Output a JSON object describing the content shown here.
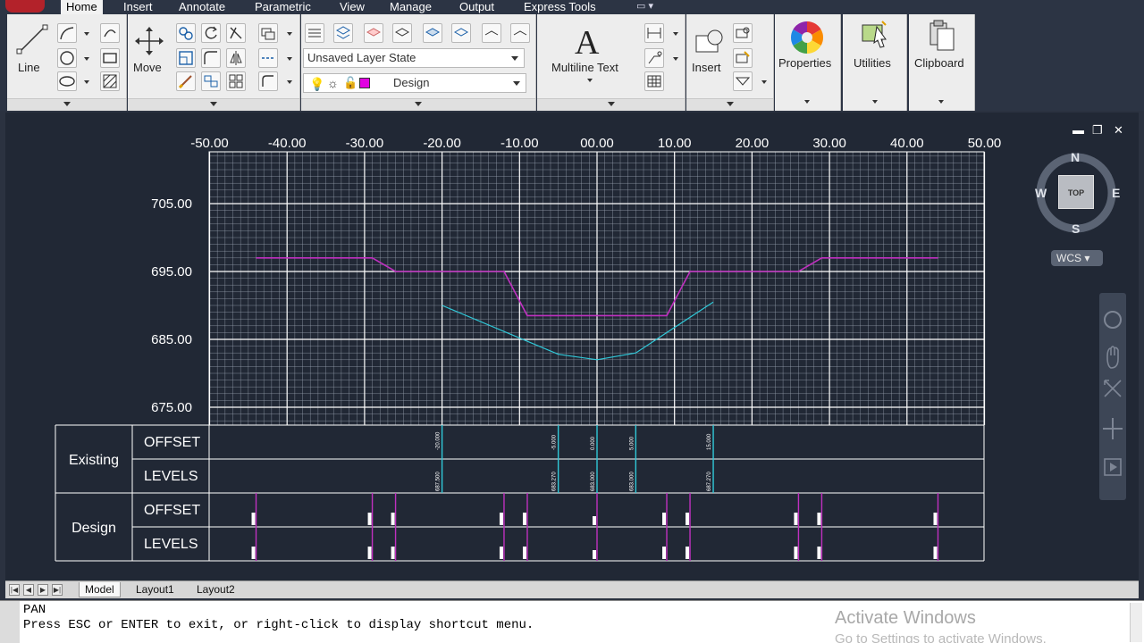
{
  "tabs": [
    "Home",
    "Insert",
    "Annotate",
    "Parametric",
    "View",
    "Manage",
    "Output",
    "Express Tools"
  ],
  "ribbon": {
    "draw": {
      "line_label": "Line"
    },
    "modify": {
      "move_label": "Move"
    },
    "layers": {
      "layer_state": "Unsaved Layer State",
      "current_layer": "Design",
      "layer_color": "#e100e1"
    },
    "annotation": {
      "mtext_label": "Multiline Text"
    },
    "block": {
      "insert_label": "Insert"
    },
    "properties_label": "Properties",
    "utilities_label": "Utilities",
    "clipboard_label": "Clipboard"
  },
  "viewport": {
    "window_controls": [
      "▬",
      "❐",
      "✕"
    ],
    "viewcube": {
      "north": "N",
      "south": "S",
      "east": "E",
      "west": "W",
      "face": "TOP",
      "wcs": "WCS"
    }
  },
  "section": {
    "x_ticks": [
      "-50.00",
      "-40.00",
      "-30.00",
      "-20.00",
      "-10.00",
      "00.00",
      "10.00",
      "20.00",
      "30.00",
      "40.00",
      "50.00"
    ],
    "y_ticks": [
      "705.00",
      "695.00",
      "685.00",
      "675.00"
    ],
    "table": {
      "groups": [
        {
          "name": "Existing",
          "rows": [
            "OFFSET",
            "LEVELS"
          ]
        },
        {
          "name": "Design",
          "rows": [
            "OFFSET",
            "LEVELS"
          ]
        }
      ],
      "existing_offsets": [
        "-20.000",
        "-5.000",
        "0.000",
        "5.000",
        "15.000"
      ],
      "existing_levels": [
        "687.500",
        "683.270",
        "683.000",
        "683.000",
        "687.270"
      ]
    },
    "colors": {
      "design": "#c030c0",
      "existing": "#30c8d8",
      "grid": "#ffffff"
    }
  },
  "layout_tabs": [
    "Model",
    "Layout1",
    "Layout2"
  ],
  "command": {
    "line1": "PAN",
    "line2": "Press ESC or ENTER to exit, or right-click to display shortcut menu."
  },
  "watermark": {
    "title": "Activate Windows",
    "subtitle": "Go to Settings to activate Windows."
  }
}
